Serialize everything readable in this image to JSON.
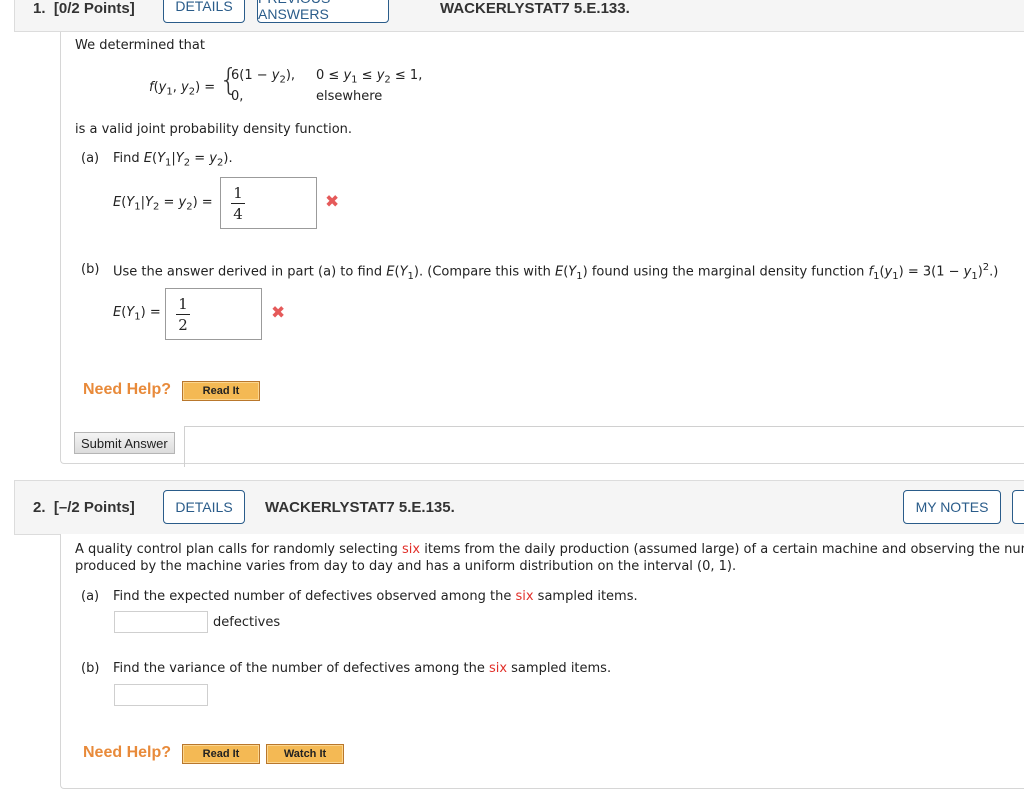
{
  "question1": {
    "number": "1.",
    "points": "[0/2 Points]",
    "details_button": "DETAILS",
    "previous_answers_button": "PREVIOUS ANSWERS",
    "code": "WACKERLYSTAT7 5.E.133.",
    "intro": "We determined that",
    "pdf_lhs": "f(y1, y2) =",
    "pdf_case1_expr": "6(1 − y2),",
    "pdf_case1_cond": "0 ≤ y1 ≤ y2 ≤ 1,",
    "pdf_case2_expr": "0,",
    "pdf_case2_cond": "elsewhere",
    "statement": "is a valid joint probability density function.",
    "part_a": {
      "label": "(a)",
      "prompt": "Find E(Y1|Y2 = y2).",
      "answer_label": "E(Y1|Y2 = y2) =",
      "answer_numerator": "1",
      "answer_denominator": "4",
      "status": "incorrect",
      "status_icon": "x-mark-icon"
    },
    "part_b": {
      "label": "(b)",
      "prompt": "Use the answer derived in part (a) to find E(Y1). (Compare this with E(Y1) found using the marginal density function f1(y1) = 3(1 − y1)2.)",
      "answer_label": "E(Y1) =",
      "answer_numerator": "1",
      "answer_denominator": "2",
      "status": "incorrect",
      "status_icon": "x-mark-icon"
    },
    "need_help": "Need Help?",
    "read_it": "Read It",
    "submit": "Submit Answer"
  },
  "question2": {
    "number": "2.",
    "points": "[–/2 Points]",
    "details_button": "DETAILS",
    "code": "WACKERLYSTAT7 5.E.135.",
    "my_notes_button": "MY NOTES",
    "intro_line1_pre": "A quality control plan calls for randomly selecting ",
    "highlight": "six",
    "intro_line1_post": " items from the daily production (assumed large) of a certain machine and observing the number o",
    "intro_line2": "produced by the machine varies from day to day and has a uniform distribution on the interval (0, 1).",
    "part_a": {
      "label": "(a)",
      "prompt_pre": "Find the expected number of defectives observed among the ",
      "prompt_post": " sampled items.",
      "input_value": "",
      "unit": "defectives"
    },
    "part_b": {
      "label": "(b)",
      "prompt_pre": "Find the variance of the number of defectives among the ",
      "prompt_post": " sampled items.",
      "input_value": ""
    },
    "need_help": "Need Help?",
    "read_it": "Read It",
    "watch_it": "Watch It"
  },
  "colors": {
    "accent_blue": "#2a5c8a",
    "highlight_red": "#e1302a",
    "help_orange": "#e88a3a",
    "button_gold": "#f4b954",
    "incorrect_red": "#e55a5a"
  }
}
